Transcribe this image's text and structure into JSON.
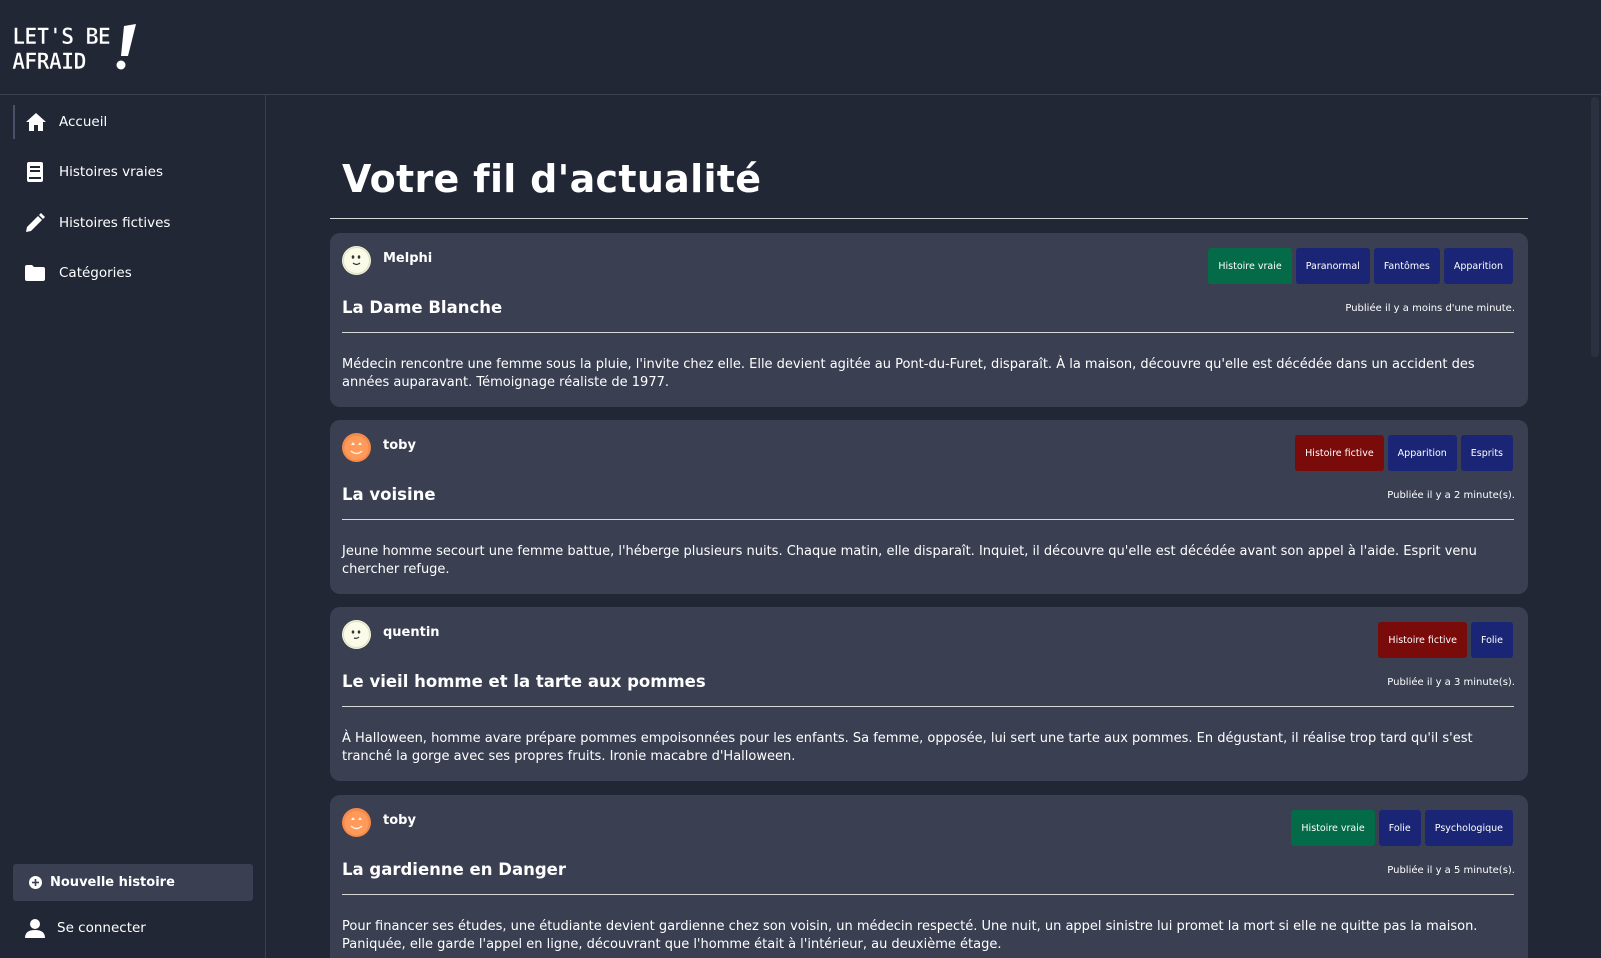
{
  "app": {
    "logo_text": "LET'S BE AFRAID!"
  },
  "sidebar": {
    "items": [
      {
        "label": "Accueil",
        "icon": "home-icon"
      },
      {
        "label": "Histoires vraies",
        "icon": "book-icon"
      },
      {
        "label": "Histoires fictives",
        "icon": "pencil-icon"
      },
      {
        "label": "Catégories",
        "icon": "folder-icon"
      }
    ],
    "new_story_label": "Nouvelle histoire",
    "login_label": "Se connecter"
  },
  "main": {
    "title": "Votre fil d'actualité"
  },
  "colors": {
    "background": "#222736",
    "card": "#3a3f52",
    "badge_true": "#046b48",
    "badge_fiction": "#7a0b0b",
    "badge_category": "#1a2675"
  },
  "stories": [
    {
      "author": "Melphi",
      "avatar": "ghost-avatar",
      "title": "La Dame Blanche",
      "date": "Publiée il y a moins d'une minute.",
      "body": "Médecin rencontre une femme sous la pluie, l'invite chez elle. Elle devient agitée au Pont-du-Furet, disparaît. À la maison, découvre qu'elle est décédée dans un accident des années auparavant. Témoignage réaliste de 1977.",
      "badges": [
        {
          "label": "Histoire vraie",
          "kind": "true"
        },
        {
          "label": "Paranormal",
          "kind": "category"
        },
        {
          "label": "Fantômes",
          "kind": "category"
        },
        {
          "label": "Apparition",
          "kind": "category"
        }
      ]
    },
    {
      "author": "toby",
      "avatar": "pumpkin-avatar",
      "title": "La voisine",
      "date": "Publiée il y a 2 minute(s).",
      "body": "Jeune homme secourt une femme battue, l'héberge plusieurs nuits. Chaque matin, elle disparaît. Inquiet, il découvre qu'elle est décédée avant son appel à l'aide. Esprit venu chercher refuge.",
      "badges": [
        {
          "label": "Histoire fictive",
          "kind": "fiction"
        },
        {
          "label": "Apparition",
          "kind": "category"
        },
        {
          "label": "Esprits",
          "kind": "category"
        }
      ]
    },
    {
      "author": "quentin",
      "avatar": "ghost-avatar",
      "title": "Le vieil homme et la tarte aux pommes",
      "date": "Publiée il y a 3 minute(s).",
      "body": "À Halloween, homme avare prépare pommes empoisonnées pour les enfants. Sa femme, opposée, lui sert une tarte aux pommes. En dégustant, il réalise trop tard qu'il s'est tranché la gorge avec ses propres fruits. Ironie macabre d'Halloween.",
      "badges": [
        {
          "label": "Histoire fictive",
          "kind": "fiction"
        },
        {
          "label": "Folie",
          "kind": "category"
        }
      ]
    },
    {
      "author": "toby",
      "avatar": "pumpkin-avatar",
      "title": "La gardienne en Danger",
      "date": "Publiée il y a 5 minute(s).",
      "body": "Pour financer ses études, une étudiante devient gardienne chez son voisin, un médecin respecté. Une nuit, un appel sinistre lui promet la mort si elle ne quitte pas la maison. Paniquée, elle garde l'appel en ligne, découvrant que l'homme était à l'intérieur, au deuxième étage.",
      "badges": [
        {
          "label": "Histoire vraie",
          "kind": "true"
        },
        {
          "label": "Folie",
          "kind": "category"
        },
        {
          "label": "Psychologique",
          "kind": "category"
        }
      ]
    }
  ]
}
